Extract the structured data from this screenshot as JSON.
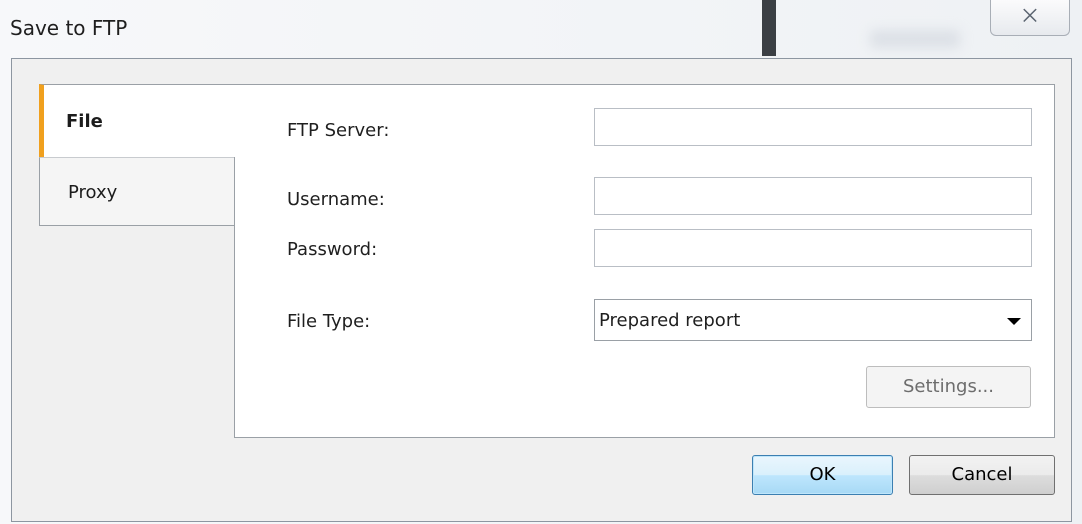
{
  "window": {
    "title": "Save to FTP",
    "close_icon": "close-icon",
    "close_glyph": "⨉"
  },
  "tabs": [
    {
      "label": "File",
      "active": true
    },
    {
      "label": "Proxy",
      "active": false
    }
  ],
  "form": {
    "ftp_server": {
      "label": "FTP Server:",
      "value": ""
    },
    "username": {
      "label": "Username:",
      "value": ""
    },
    "password": {
      "label": "Password:",
      "value": ""
    },
    "file_type": {
      "label": "File Type:",
      "selected": "Prepared report"
    },
    "settings_button": "Settings..."
  },
  "footer": {
    "ok_label": "OK",
    "cancel_label": "Cancel"
  },
  "colors": {
    "active_tab_accent": "#f0a01e",
    "default_button_border": "#3c7fb1"
  }
}
